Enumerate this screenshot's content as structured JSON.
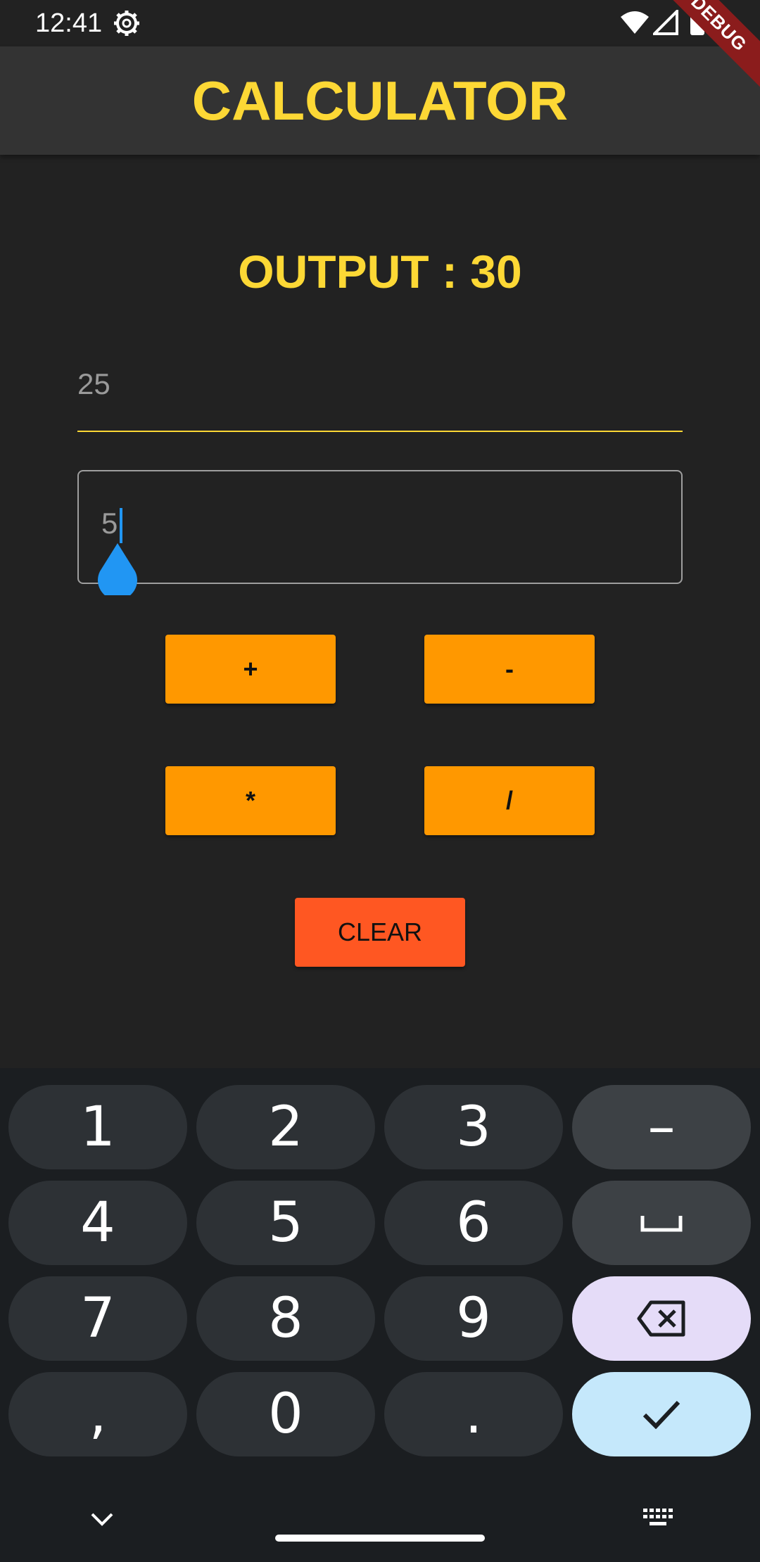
{
  "status_bar": {
    "time": "12:41"
  },
  "debug_banner": "DEBUG",
  "app_bar": {
    "title": "CALCULATOR"
  },
  "output": {
    "text": "OUTPUT : 30"
  },
  "inputs": {
    "first_number": {
      "value": "25"
    },
    "second_number": {
      "value": "5"
    }
  },
  "buttons": {
    "add": "+",
    "subtract": "-",
    "multiply": "*",
    "divide": "/",
    "clear": "CLEAR"
  },
  "keyboard": {
    "keys": {
      "k1": "1",
      "k2": "2",
      "k3": "3",
      "minus": "–",
      "k4": "4",
      "k5": "5",
      "k6": "6",
      "k7": "7",
      "k8": "8",
      "k9": "9",
      "comma": ",",
      "k0": "0",
      "dot": "."
    },
    "icons": {
      "space": "space-icon",
      "backspace": "backspace-icon",
      "enter": "checkmark-icon",
      "hide": "chevron-down-icon",
      "switch": "keyboard-icon"
    }
  },
  "colors": {
    "accent_yellow": "#FDD835",
    "operator_orange": "#FF9800",
    "clear_red": "#FF5722",
    "cursor_blue": "#2196F3"
  }
}
